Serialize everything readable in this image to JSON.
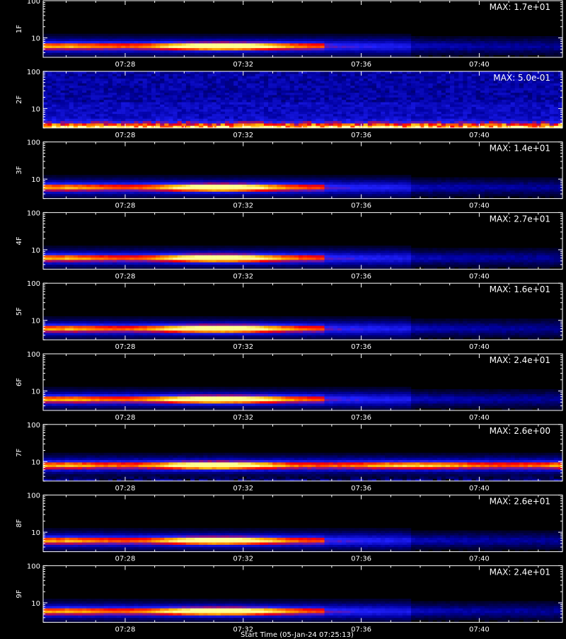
{
  "chart_data": {
    "type": "heatmap",
    "figure_label": "Start Time (05-Jan-24 07:25:13)",
    "x_tick_labels": [
      "07:28",
      "07:32",
      "07:36",
      "07:40"
    ],
    "y_tick_labels": [
      "100",
      "10"
    ],
    "time_range_minutes": [
      0,
      17.6
    ],
    "y_scale": "log",
    "y_range": [
      3,
      100
    ],
    "colormap": [
      "#000000",
      "#0000a0",
      "#2020ff",
      "#ff0000",
      "#ffb000",
      "#ffff90"
    ],
    "panels": [
      {
        "label": "1F",
        "max_label": "MAX: 1.7e+01",
        "noise": "low",
        "band_center": 6,
        "peak_minute": 5.9,
        "peak_width": 2.3,
        "tail_end": 9.5
      },
      {
        "label": "2F",
        "max_label": "MAX: 5.0e-01",
        "noise": "high",
        "band_center": 3.5,
        "peak_minute": 6.0,
        "peak_width": 3.0,
        "tail_end": 17.6
      },
      {
        "label": "3F",
        "max_label": "MAX: 1.4e+01",
        "noise": "low",
        "band_center": 6,
        "peak_minute": 5.8,
        "peak_width": 2.0,
        "tail_end": 9.5
      },
      {
        "label": "4F",
        "max_label": "MAX: 2.7e+01",
        "noise": "low",
        "band_center": 6,
        "peak_minute": 5.8,
        "peak_width": 2.0,
        "tail_end": 9.5
      },
      {
        "label": "5F",
        "max_label": "MAX: 1.6e+01",
        "noise": "low",
        "band_center": 6,
        "peak_minute": 5.8,
        "peak_width": 2.3,
        "tail_end": 9.5
      },
      {
        "label": "6F",
        "max_label": "MAX: 2.4e+01",
        "noise": "low",
        "band_center": 6,
        "peak_minute": 5.8,
        "peak_width": 2.3,
        "tail_end": 9.5
      },
      {
        "label": "7F",
        "max_label": "MAX: 2.6e+00",
        "noise": "mid",
        "band_center": 8,
        "peak_minute": 5.6,
        "peak_width": 2.0,
        "tail_end": 17.6
      },
      {
        "label": "8F",
        "max_label": "MAX: 2.6e+01",
        "noise": "low",
        "band_center": 6,
        "peak_minute": 5.8,
        "peak_width": 2.0,
        "tail_end": 9.5
      },
      {
        "label": "9F",
        "max_label": "MAX: 2.4e+01",
        "noise": "low",
        "band_center": 6,
        "peak_minute": 5.8,
        "peak_width": 2.3,
        "tail_end": 9.5
      }
    ]
  }
}
